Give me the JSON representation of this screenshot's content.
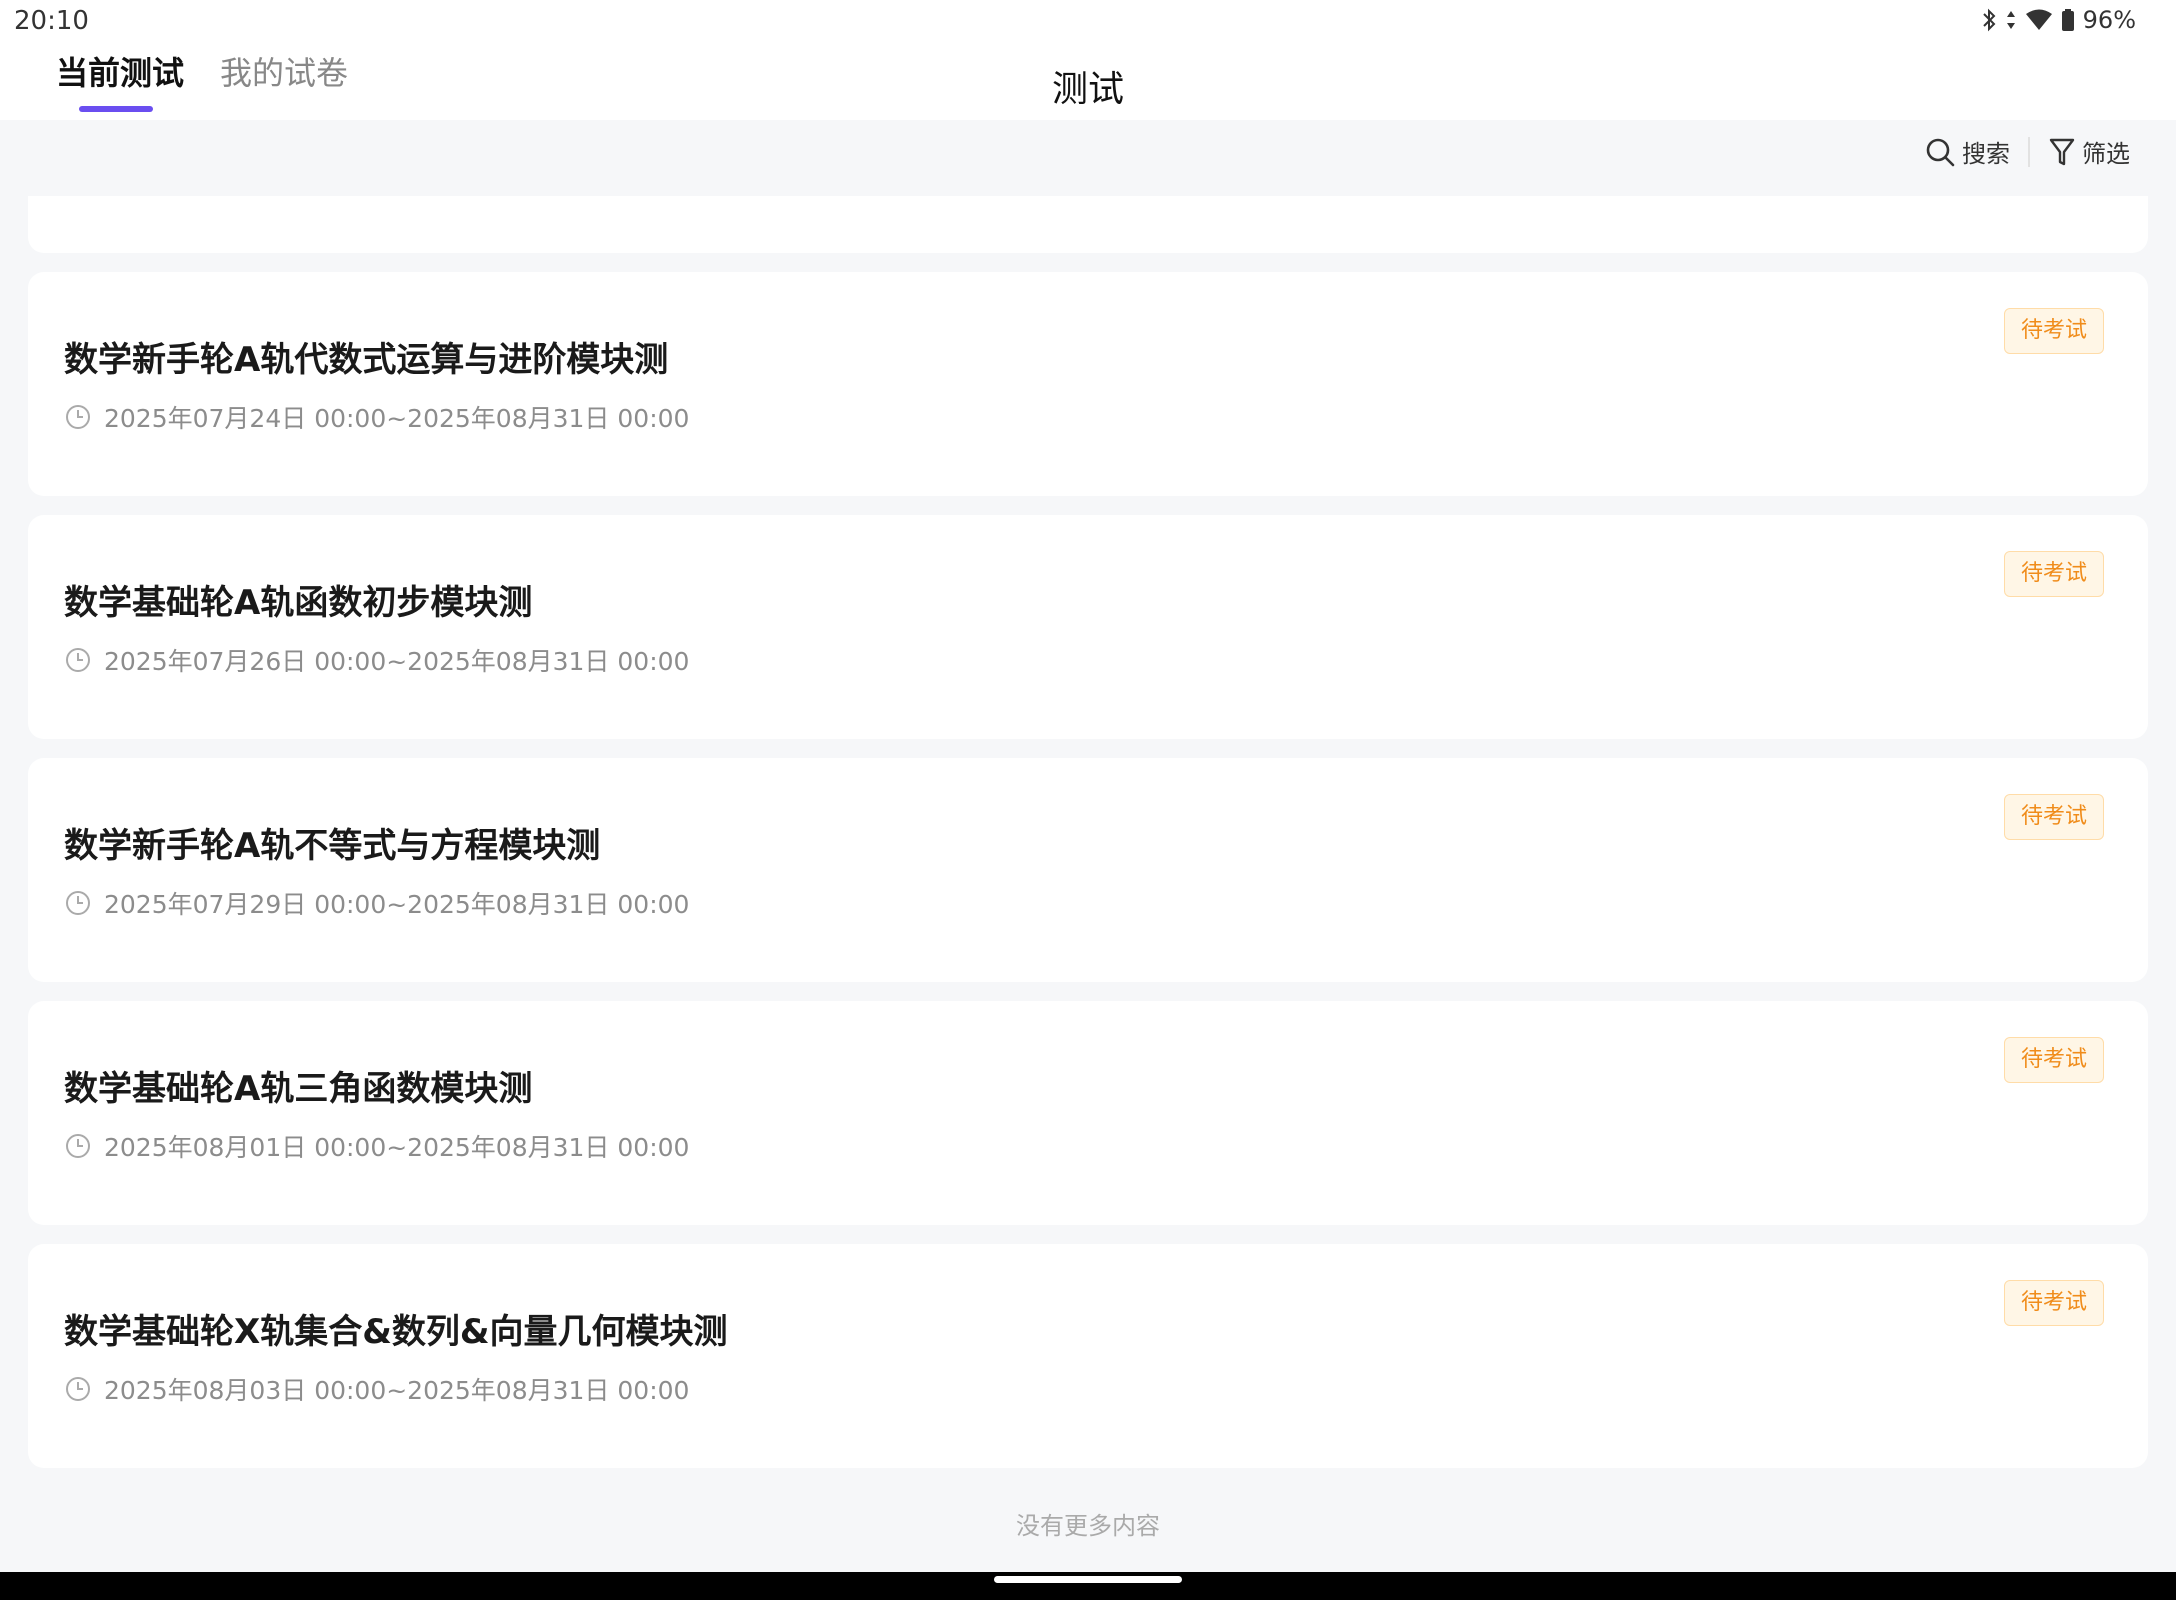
{
  "status_bar": {
    "time": "20:10",
    "battery": "96%"
  },
  "tabs": [
    {
      "label": "当前测试",
      "active": true
    },
    {
      "label": "我的试卷",
      "active": false
    }
  ],
  "page_title": "测试",
  "toolbar": {
    "search_label": "搜索",
    "filter_label": "筛选"
  },
  "exams": [
    {
      "title": "数学新手轮A轨代数式运算与进阶模块测",
      "time_range": "2025年07月24日 00:00~2025年08月31日 00:00",
      "status": "待考试"
    },
    {
      "title": "数学基础轮A轨函数初步模块测",
      "time_range": "2025年07月26日 00:00~2025年08月31日 00:00",
      "status": "待考试"
    },
    {
      "title": "数学新手轮A轨不等式与方程模块测",
      "time_range": "2025年07月29日 00:00~2025年08月31日 00:00",
      "status": "待考试"
    },
    {
      "title": "数学基础轮A轨三角函数模块测",
      "time_range": "2025年08月01日 00:00~2025年08月31日 00:00",
      "status": "待考试"
    },
    {
      "title": "数学基础轮X轨集合&数列&向量几何模块测",
      "time_range": "2025年08月03日 00:00~2025年08月31日 00:00",
      "status": "待考试"
    }
  ],
  "footer_note": "没有更多内容",
  "colors": {
    "accent": "#6a4ef0",
    "badge_text": "#f08c1a",
    "badge_bg": "#fff6e6"
  }
}
